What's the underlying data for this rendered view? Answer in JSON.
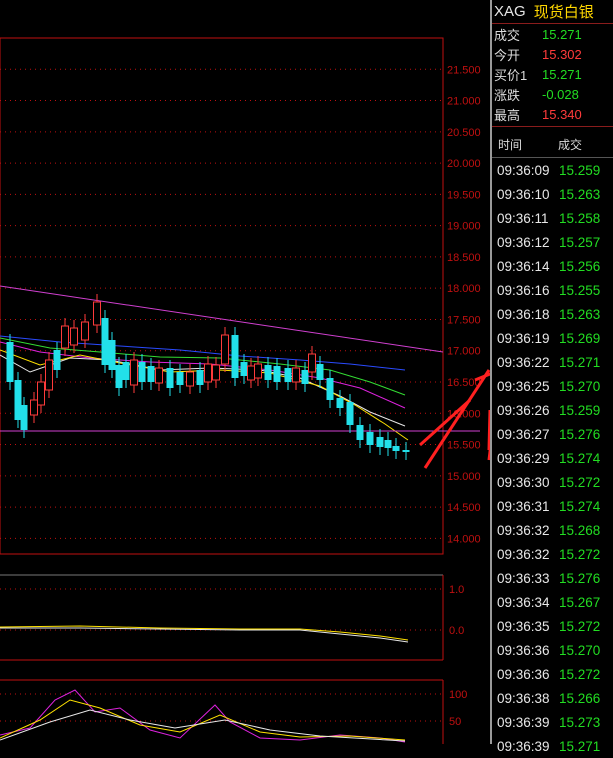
{
  "quote": {
    "symbol": "XAG",
    "name": "现货白银",
    "rows": [
      {
        "label": "成交",
        "value": "15.271",
        "color": "#22dd22"
      },
      {
        "label": "今开",
        "value": "15.302",
        "color": "#ff3b3b"
      },
      {
        "label": "买价1",
        "value": "15.271",
        "color": "#22dd22"
      },
      {
        "label": "涨跌",
        "value": "-0.028",
        "color": "#22dd22"
      },
      {
        "label": "最高",
        "value": "15.340",
        "color": "#ff3b3b"
      }
    ]
  },
  "ticks": {
    "col_time": "时间",
    "col_price": "成交",
    "rows": [
      {
        "time": "09:36:09",
        "price": "15.259"
      },
      {
        "time": "09:36:10",
        "price": "15.263"
      },
      {
        "time": "09:36:11",
        "price": "15.258"
      },
      {
        "time": "09:36:12",
        "price": "15.257"
      },
      {
        "time": "09:36:14",
        "price": "15.256"
      },
      {
        "time": "09:36:16",
        "price": "15.255"
      },
      {
        "time": "09:36:18",
        "price": "15.263"
      },
      {
        "time": "09:36:19",
        "price": "15.269"
      },
      {
        "time": "09:36:22",
        "price": "15.271"
      },
      {
        "time": "09:36:25",
        "price": "15.270"
      },
      {
        "time": "09:36:26",
        "price": "15.259"
      },
      {
        "time": "09:36:27",
        "price": "15.276"
      },
      {
        "time": "09:36:29",
        "price": "15.274"
      },
      {
        "time": "09:36:30",
        "price": "15.272"
      },
      {
        "time": "09:36:31",
        "price": "15.274"
      },
      {
        "time": "09:36:32",
        "price": "15.268"
      },
      {
        "time": "09:36:32",
        "price": "15.272"
      },
      {
        "time": "09:36:33",
        "price": "15.276"
      },
      {
        "time": "09:36:34",
        "price": "15.267"
      },
      {
        "time": "09:36:35",
        "price": "15.272"
      },
      {
        "time": "09:36:36",
        "price": "15.270"
      },
      {
        "time": "09:36:36",
        "price": "15.272"
      },
      {
        "time": "09:36:38",
        "price": "15.266"
      },
      {
        "time": "09:36:39",
        "price": "15.273"
      },
      {
        "time": "09:36:39",
        "price": "15.271"
      }
    ]
  },
  "price_axis": {
    "ticks": [
      "21.500",
      "21.000",
      "20.500",
      "20.000",
      "19.500",
      "19.000",
      "18.500",
      "18.000",
      "17.500",
      "17.000",
      "16.500",
      "16.000",
      "15.500",
      "15.000",
      "14.500",
      "14.000"
    ],
    "min": 13.75,
    "max": 22.0
  },
  "indicator1_axis": {
    "ticks": [
      "1.0",
      "0.0"
    ]
  },
  "indicator2_axis": {
    "ticks": [
      "100",
      "50"
    ]
  },
  "colors": {
    "up": "#ff3b3b",
    "down": "#22e0ea",
    "axis_border": "#c01010",
    "trendline": "#d040d0",
    "annotation_arrow": "#ff2020"
  }
}
